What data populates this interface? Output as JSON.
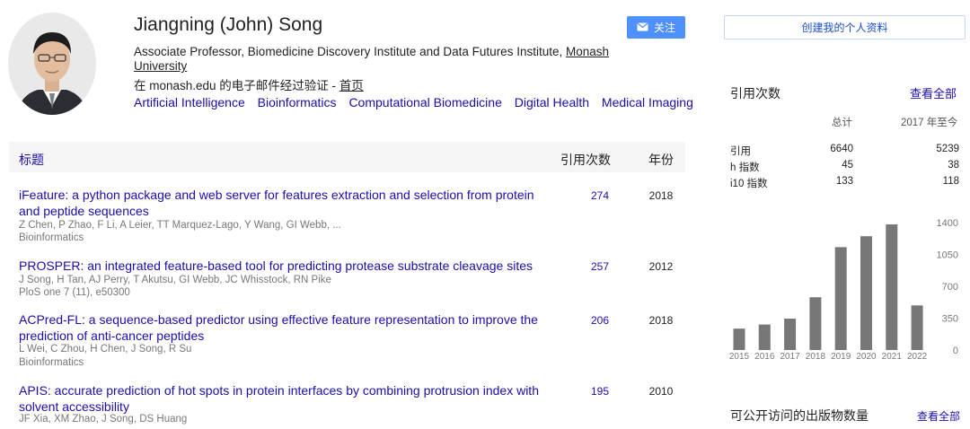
{
  "profile": {
    "name": "Jiangning (John) Song",
    "affiliation_prefix": "Associate Professor, Biomedicine Discovery Institute and Data Futures Institute, ",
    "affiliation_link": "Monash University",
    "verified_text": "在 monash.edu 的电子邮件经过验证 - ",
    "homepage_link": "首页",
    "tags": [
      "Artificial Intelligence",
      "Bioinformatics",
      "Computational Biomedicine",
      "Digital Health",
      "Medical Imaging"
    ]
  },
  "buttons": {
    "follow": "关注",
    "create_profile": "创建我的个人资料"
  },
  "table": {
    "headers": {
      "title": "标题",
      "cited_by": "引用次数",
      "year": "年份"
    },
    "publications": [
      {
        "title": "iFeature: a python package and web server for features extraction and selection from protein and peptide sequences",
        "authors": "Z Chen, P Zhao, F Li, A Leier, TT Marquez-Lago, Y Wang, GI Webb, ...",
        "venue": "Bioinformatics",
        "cites": "274",
        "year": "2018"
      },
      {
        "title": "PROSPER: an integrated feature-based tool for predicting protease substrate cleavage sites",
        "authors": "J Song, H Tan, AJ Perry, T Akutsu, GI Webb, JC Whisstock, RN Pike",
        "venue": "PloS one 7 (11), e50300",
        "cites": "257",
        "year": "2012"
      },
      {
        "title": "ACPred-FL: a sequence-based predictor using effective feature representation to improve the prediction of anti-cancer peptides",
        "authors": "L Wei, C Zhou, H Chen, J Song, R Su",
        "venue": "Bioinformatics",
        "cites": "206",
        "year": "2018"
      },
      {
        "title": "APIS: accurate prediction of hot spots in protein interfaces by combining protrusion index with solvent accessibility",
        "authors": "JF Xia, XM Zhao, J Song, DS Huang",
        "venue": "",
        "cites": "195",
        "year": "2010"
      }
    ]
  },
  "citations": {
    "heading": "引用次数",
    "view_all": "查看全部",
    "col_total": "总计",
    "col_since": "2017 年至今",
    "rows": [
      {
        "label": "引用",
        "total": "6640",
        "since": "5239"
      },
      {
        "label": "h 指数",
        "total": "45",
        "since": "38"
      },
      {
        "label": "i10 指数",
        "total": "133",
        "since": "118"
      }
    ]
  },
  "chart_data": {
    "type": "bar",
    "categories": [
      "2015",
      "2016",
      "2017",
      "2018",
      "2019",
      "2020",
      "2021",
      "2022"
    ],
    "values": [
      235,
      280,
      345,
      580,
      1130,
      1250,
      1380,
      490
    ],
    "ylim": [
      0,
      1400
    ],
    "yticks": [
      0,
      350,
      700,
      1050,
      1400
    ],
    "bar_color": "#777777"
  },
  "open_access": {
    "heading": "可公开访问的出版物数量",
    "view_all": "查看全部"
  },
  "colors": {
    "link": "#1a0dab",
    "follow_button": "#4d90fe"
  }
}
